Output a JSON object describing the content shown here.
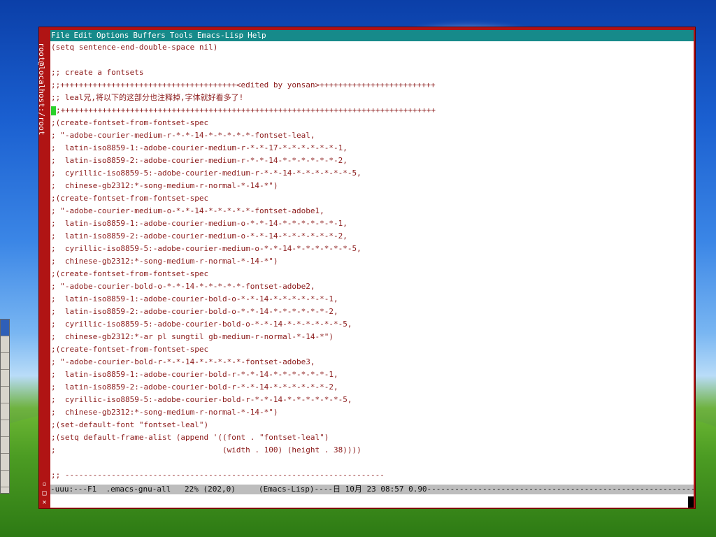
{
  "window": {
    "title": "root@localhost:/root"
  },
  "menubar": {
    "items": [
      "File",
      "Edit",
      "Options",
      "Buffers",
      "Tools",
      "Emacs-Lisp",
      "Help"
    ]
  },
  "buffer": {
    "lines": [
      "(setq sentence-end-double-space nil)",
      "",
      ";; create a fontsets",
      ";;++++++++++++++++++++++++++++++++++++++<edited by yonsan>+++++++++++++++++++++++++",
      ";; leal兄,将以下的这部分也注释掉,字体就好看多了!",
      ";;+++++++++++++++++++++++++++++++++++++++++++++++++++++++++++++++++++++++++++++++++",
      ";(create-fontset-from-fontset-spec",
      "; \"-adobe-courier-medium-r-*-*-14-*-*-*-*-*-fontset-leal,",
      ";  latin-iso8859-1:-adobe-courier-medium-r-*-*-17-*-*-*-*-*-*-1,",
      ";  latin-iso8859-2:-adobe-courier-medium-r-*-*-14-*-*-*-*-*-*-2,",
      ";  cyrillic-iso8859-5:-adobe-courier-medium-r-*-*-14-*-*-*-*-*-*-5,",
      ";  chinese-gb2312:*-song-medium-r-normal-*-14-*\")",
      ";(create-fontset-from-fontset-spec",
      "; \"-adobe-courier-medium-o-*-*-14-*-*-*-*-*-fontset-adobe1,",
      ";  latin-iso8859-1:-adobe-courier-medium-o-*-*-14-*-*-*-*-*-*-1,",
      ";  latin-iso8859-2:-adobe-courier-medium-o-*-*-14-*-*-*-*-*-*-2,",
      ";  cyrillic-iso8859-5:-adobe-courier-medium-o-*-*-14-*-*-*-*-*-*-5,",
      ";  chinese-gb2312:*-song-medium-r-normal-*-14-*\")",
      ";(create-fontset-from-fontset-spec",
      "; \"-adobe-courier-bold-o-*-*-14-*-*-*-*-*-fontset-adobe2,",
      ";  latin-iso8859-1:-adobe-courier-bold-o-*-*-14-*-*-*-*-*-*-1,",
      ";  latin-iso8859-2:-adobe-courier-bold-o-*-*-14-*-*-*-*-*-*-2,",
      ";  cyrillic-iso8859-5:-adobe-courier-bold-o-*-*-14-*-*-*-*-*-*-5,",
      ";  chinese-gb2312:*-ar pl sungtil gb-medium-r-normal-*-14-*\")",
      ";(create-fontset-from-fontset-spec",
      "; \"-adobe-courier-bold-r-*-*-14-*-*-*-*-*-fontset-adobe3,",
      ";  latin-iso8859-1:-adobe-courier-bold-r-*-*-14-*-*-*-*-*-*-1,",
      ";  latin-iso8859-2:-adobe-courier-bold-r-*-*-14-*-*-*-*-*-*-2,",
      ";  cyrillic-iso8859-5:-adobe-courier-bold-r-*-*-14-*-*-*-*-*-*-5,",
      ";  chinese-gb2312:*-song-medium-r-normal-*-14-*\")",
      ";(set-default-font \"fontset-leal\")",
      ";(setq default-frame-alist (append '((font . \"fontset-leal\")",
      ";                                    (width . 100) (height . 38))))",
      "",
      ";; ---------------------------------------------------------------------"
    ],
    "cursor_line": 5
  },
  "modeline": {
    "text": "-uuu:---F1  .emacs-gnu-all   22% (202,0)     (Emacs-Lisp)----日 10月 23 08:57 0.90-------------------------------------------------------------"
  },
  "colors": {
    "frame": "#b01414",
    "menubar": "#168a8a",
    "code_text": "#8b1a1a",
    "modeline": "#bdbdbd",
    "cursor": "#2bd12b"
  }
}
